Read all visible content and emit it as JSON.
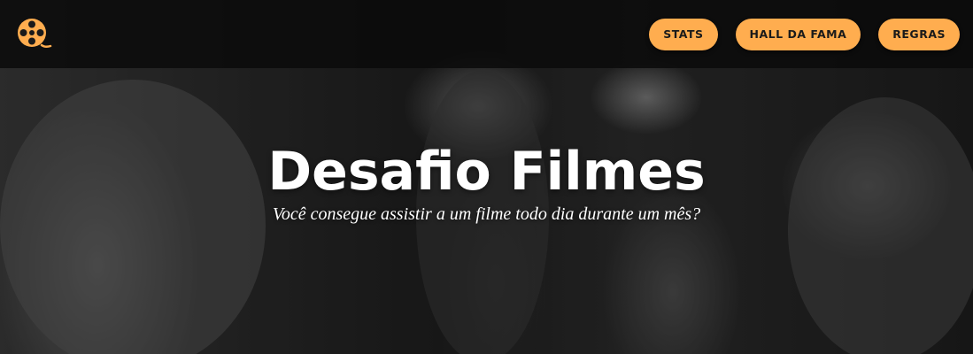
{
  "header": {
    "logo_icon": "film-reel-icon",
    "accent_color": "#ffad4f",
    "nav": [
      {
        "label": "STATS"
      },
      {
        "label": "HALL DA FAMA"
      },
      {
        "label": "REGRAS"
      }
    ]
  },
  "hero": {
    "title": "Desafio Filmes",
    "subtitle": "Você consegue assistir a um filme todo dia durante um mês?"
  }
}
